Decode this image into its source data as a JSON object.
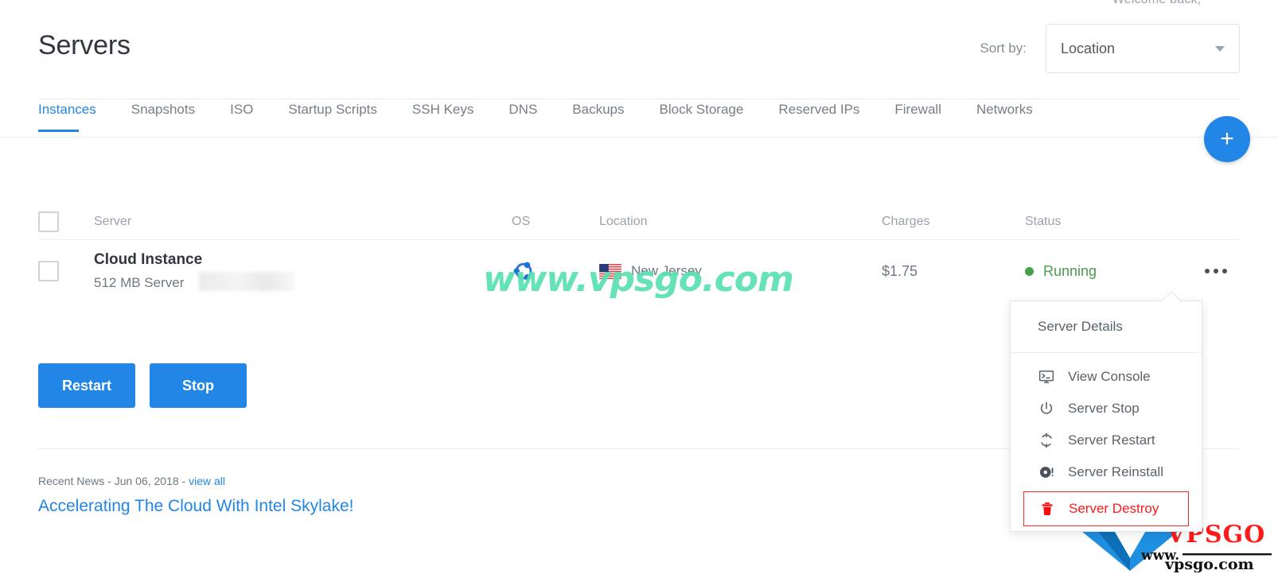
{
  "header": {
    "welcome": "Welcome back,",
    "welcome_user": "   ",
    "title": "Servers",
    "sort_label": "Sort by:",
    "sort_value": "Location",
    "caret_icon": "chevron-down-icon"
  },
  "tabs": [
    {
      "label": "Instances",
      "active": true
    },
    {
      "label": "Snapshots",
      "active": false
    },
    {
      "label": "ISO",
      "active": false
    },
    {
      "label": "Startup Scripts",
      "active": false
    },
    {
      "label": "SSH Keys",
      "active": false
    },
    {
      "label": "DNS",
      "active": false
    },
    {
      "label": "Backups",
      "active": false
    },
    {
      "label": "Block Storage",
      "active": false
    },
    {
      "label": "Reserved IPs",
      "active": false
    },
    {
      "label": "Firewall",
      "active": false
    },
    {
      "label": "Networks",
      "active": false
    }
  ],
  "fab": {
    "label": "+",
    "icon": "plus-icon",
    "color": "#2286e6"
  },
  "table": {
    "columns": {
      "server": "Server",
      "os": "OS",
      "location": "Location",
      "charges": "Charges",
      "status": "Status"
    },
    "rows": [
      {
        "name": "Cloud Instance",
        "sub": "512 MB Server",
        "os_icon": "ubuntu-icon",
        "location_flag": "us-flag-icon",
        "location": "New Jersey",
        "charges": "$1.75",
        "status": "Running",
        "status_color": "#45a049",
        "menu_icon": "kebab-menu-icon"
      }
    ]
  },
  "actions": {
    "restart_label": "Restart",
    "stop_label": "Stop",
    "button_color": "#2286e6"
  },
  "news": {
    "meta_prefix": "Recent News - Jun 06, 2018 - ",
    "view_all": "view all",
    "headline": "Accelerating The Cloud With Intel Skylake!"
  },
  "menu": {
    "header": "Server Details",
    "items": [
      {
        "label": "View Console",
        "icon": "monitor-console-icon",
        "danger": false
      },
      {
        "label": "Server Stop",
        "icon": "power-icon",
        "danger": false
      },
      {
        "label": "Server Restart",
        "icon": "refresh-icon",
        "danger": false
      },
      {
        "label": "Server Reinstall",
        "icon": "disc-icon",
        "danger": false
      },
      {
        "label": "Server Destroy",
        "icon": "trash-icon",
        "danger": true
      }
    ],
    "danger_color": "#ff1a1a"
  },
  "watermarks": {
    "center_text": "www.vpsgo.com",
    "center_color": "#58e0b0",
    "logo_brand": "VPSGO",
    "logo_www": "www.",
    "logo_domain": "vpsgo.com"
  }
}
